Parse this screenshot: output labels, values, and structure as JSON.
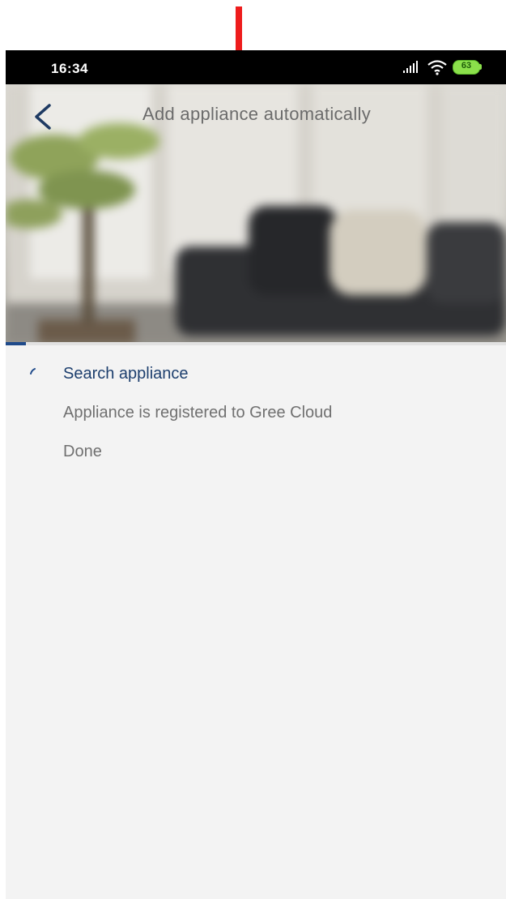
{
  "status_bar": {
    "time": "16:34",
    "signal_icon": "signal-bars-icon",
    "wifi_icon": "wifi-icon",
    "battery_level": "63"
  },
  "header": {
    "title": "Add appliance automatically",
    "back_icon": "chevron-left-icon"
  },
  "progress": {
    "fraction": 0.04,
    "color": "#1f4a8a"
  },
  "steps": [
    {
      "label": "Search appliance",
      "state": "active"
    },
    {
      "label": "Appliance is registered to Gree Cloud",
      "state": "pending"
    },
    {
      "label": "Done",
      "state": "pending"
    }
  ],
  "colors": {
    "active_step": "#1d3f6e",
    "pending_step": "#707070",
    "annotation_arrow": "#ee1c1c",
    "background": "#f3f3f3"
  }
}
